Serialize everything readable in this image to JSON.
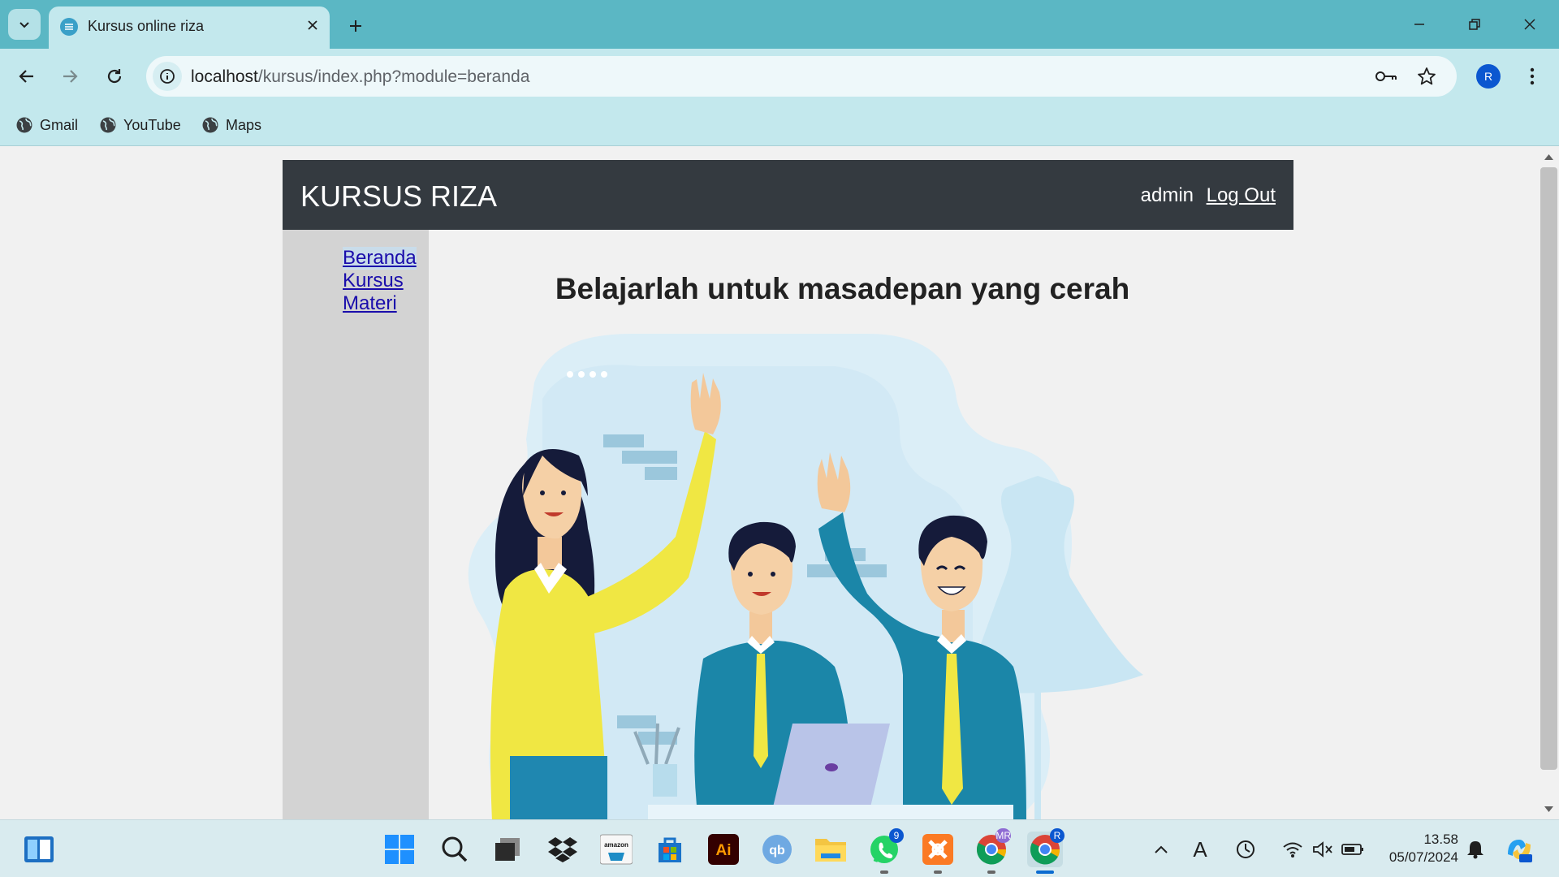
{
  "browser": {
    "tab_title": "Kursus online riza",
    "url_host": "localhost",
    "url_path": "/kursus/index.php?module=beranda",
    "profile_initial": "R",
    "bookmarks": [
      {
        "label": "Gmail",
        "icon": "globe-icon"
      },
      {
        "label": "YouTube",
        "icon": "globe-icon"
      },
      {
        "label": "Maps",
        "icon": "globe-icon"
      }
    ]
  },
  "site": {
    "brand": "KURSUS RIZA",
    "user": "admin",
    "logout_label": "Log Out",
    "menu": [
      {
        "label": "Beranda",
        "active": true
      },
      {
        "label": "Kursus",
        "active": false
      },
      {
        "label": "Materi",
        "active": false
      }
    ],
    "hero_title": "Belajarlah untuk masadepan yang cerah",
    "header_color": "#343a40",
    "sidebar_color": "#d3d3d3"
  },
  "taskbar": {
    "apps": [
      "search-icon",
      "task-view-icon",
      "dropbox-icon",
      "amazon-icon",
      "store-icon",
      "illustrator-icon",
      "qbittorrent-icon",
      "file-explorer-icon",
      "whatsapp-icon",
      "xampp-icon",
      "chrome-profile-icon",
      "chrome-icon"
    ],
    "illustrator_label": "Ai",
    "qbittorrent_label": "qb",
    "amazon_label": "amazon",
    "whatsapp_badge": "9",
    "chrome_profile_badge": "MR",
    "chrome_badge": "R",
    "tray_letter": "A",
    "time": "13.58",
    "date": "05/07/2024"
  }
}
